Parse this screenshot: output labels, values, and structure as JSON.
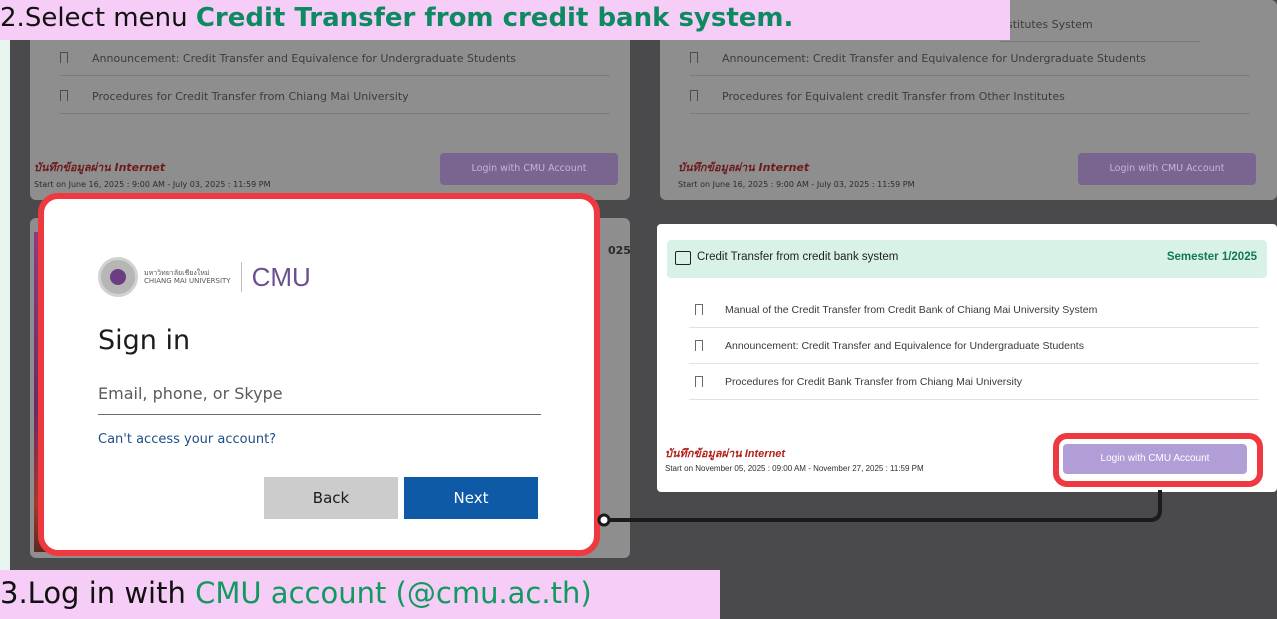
{
  "step2": {
    "number": "2.",
    "prefix": "Select menu ",
    "highlight": "Credit Transfer from credit bank system."
  },
  "step3": {
    "number": "3.",
    "prefix": "Log in with ",
    "highlight": "CMU account (@cmu.ac.th)"
  },
  "background": {
    "left_card": {
      "rows": [
        "Announcement: Credit Transfer and Equivalence for Undergraduate Students",
        "Procedures for Credit Transfer from Chiang Mai University"
      ],
      "record_label": "บันทึกข้อมูลผ่าน Internet",
      "date": "Start on June 16, 2025 : 9:00 AM - July 03, 2025 : 11:59 PM",
      "login_label": "Login with CMU Account"
    },
    "right_card": {
      "top_row": "nstitutes System",
      "rows": [
        "Announcement: Credit Transfer and Equivalence for Undergraduate Students",
        "Procedures for Equivalent credit Transfer from Other Institutes"
      ],
      "record_label": "บันทึกข้อมูลผ่าน Internet",
      "date": "Start on June 16, 2025 : 9:00 AM - July 03, 2025 : 11:59 PM",
      "login_label": "Login with CMU Account"
    },
    "left_lower_year": "025"
  },
  "signin": {
    "university_thai": "มหาวิทยาลัยเชียงใหม่",
    "university_en": "CHIANG MAI UNIVERSITY",
    "brand": "CMU",
    "title": "Sign in",
    "email_placeholder": "Email, phone, or Skype",
    "email_value": "",
    "cant_access": "Can't access your account?",
    "back_label": "Back",
    "next_label": "Next"
  },
  "credit_panel": {
    "title": "Credit Transfer from credit bank system",
    "semester": "Semester 1/2025",
    "items": [
      "Manual of the Credit Transfer from Credit Bank of Chiang Mai University System",
      "Announcement: Credit Transfer and Equivalence for Undergraduate Students",
      "Procedures for Credit Bank Transfer from Chiang Mai University"
    ],
    "record_label": "บันทึกข้อมูลผ่าน Internet",
    "date": "Start on November 05, 2025 : 09:00 AM - November 27, 2025 : 11:59 PM",
    "login_label": "Login with CMU Account"
  },
  "colors": {
    "highlight_green": "#0e8a63",
    "banner_pink": "#f6cdf6",
    "callout_red": "#ef3940",
    "next_blue": "#0f5aa6",
    "login_purple": "#b29ed7"
  }
}
